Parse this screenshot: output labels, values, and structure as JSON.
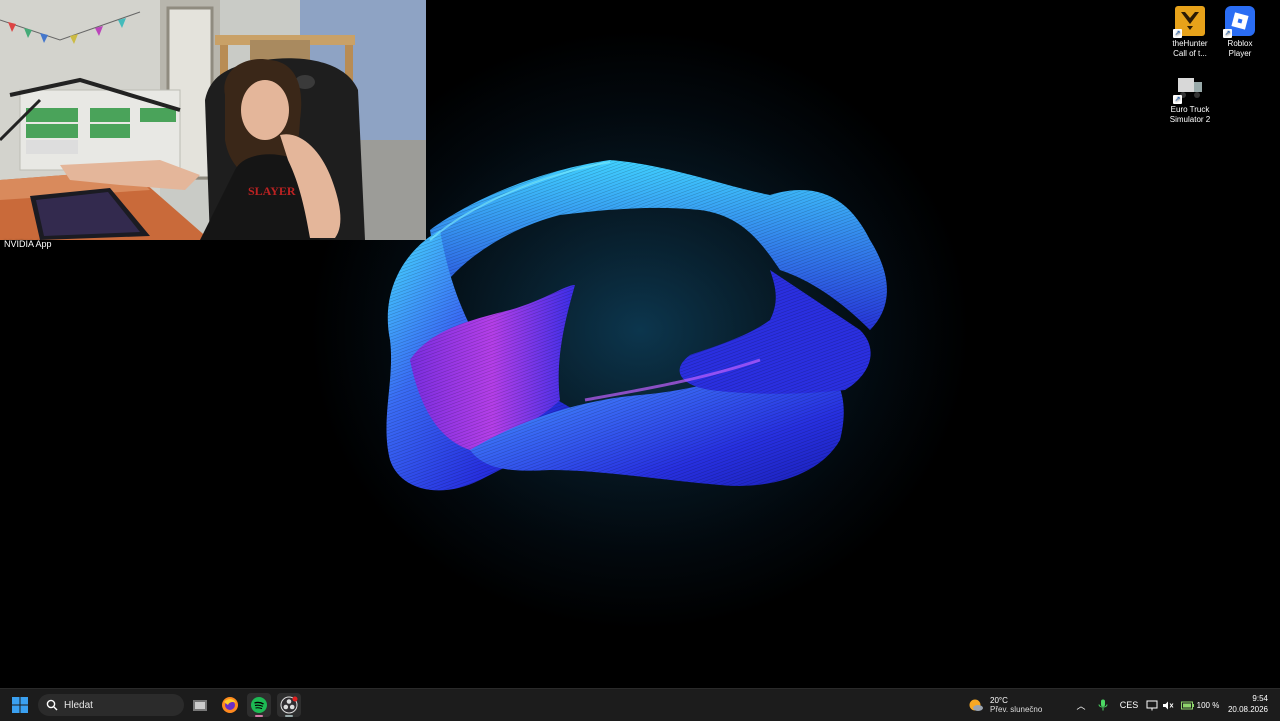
{
  "webcam": {
    "label": "NVIDIA App",
    "shirt_text": "SLAYER"
  },
  "desktop_icons": [
    {
      "name": "thehunter",
      "label": "theHunter Call of t...",
      "icon": "thehunter-game-icon"
    },
    {
      "name": "roblox",
      "label": "Roblox Player",
      "icon": "roblox-icon"
    },
    {
      "name": "euro-truck",
      "label": "Euro Truck Simulator 2",
      "icon": "truck-icon"
    }
  ],
  "taskbar": {
    "search_label": "Hledat",
    "apps": [
      {
        "name": "file-explorer",
        "icon": "folder-icon"
      },
      {
        "name": "firefox",
        "icon": "firefox-icon"
      },
      {
        "name": "spotify",
        "icon": "spotify-icon",
        "active": true
      },
      {
        "name": "obs",
        "icon": "obs-icon",
        "active": true
      }
    ]
  },
  "weather": {
    "temperature": "20°C",
    "condition": "Přev. slunečno"
  },
  "tray": {
    "language": "CES",
    "battery": "100 %"
  },
  "clock": {
    "time": "9:54",
    "date": "20.08.2026"
  },
  "colors": {
    "taskbar": "#1c1c1c",
    "accent_spotify": "#1db954",
    "wallpaper_ribbon_blue": "#2a3cf0",
    "wallpaper_ribbon_cyan": "#3fd6ff",
    "wallpaper_ribbon_magenta": "#b638e8"
  }
}
